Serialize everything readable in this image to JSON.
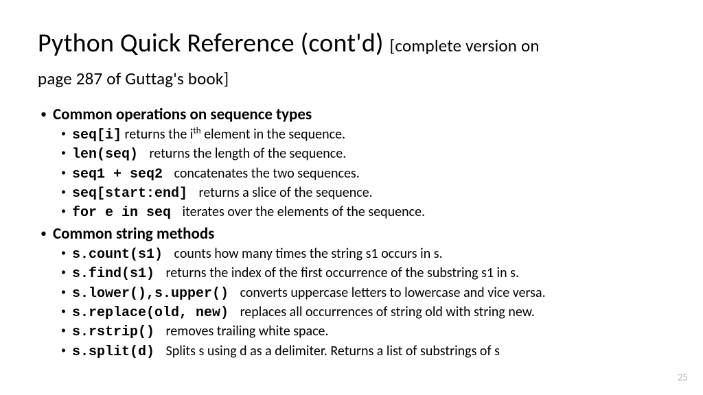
{
  "title_main": "Python Quick Reference (cont'd) ",
  "title_sub_a": "[complete version on",
  "title_sub_b": "page 287 of Guttag's book]",
  "section1": {
    "heading": "Common operations on sequence types",
    "items": [
      {
        "code": "seq[i]",
        "desc_pre": " returns the i",
        "sup": "th",
        "desc_post": " element in the sequence."
      },
      {
        "code": "len(seq) ",
        "desc": " returns the length of the sequence."
      },
      {
        "code": "seq1 + seq2 ",
        "desc": " concatenates the two sequences."
      },
      {
        "code": "seq[start:end] ",
        "desc": " returns a slice of the sequence."
      },
      {
        "code": "for e in seq ",
        "desc": " iterates over the elements of the sequence."
      }
    ]
  },
  "section2": {
    "heading": "Common string methods",
    "items": [
      {
        "code": "s.count(s1) ",
        "desc": " counts how many times the string s1 occurs in s."
      },
      {
        "code": "s.find(s1) ",
        "desc": " returns the index of the first occurrence of the substring s1 in s."
      },
      {
        "code": "s.lower(),s.upper() ",
        "desc": " converts uppercase letters to lowercase and vice versa."
      },
      {
        "code": "s.replace(old, new) ",
        "desc": " replaces all occurrences of string old with string new."
      },
      {
        "code": "s.rstrip() ",
        "desc": " removes trailing white space."
      },
      {
        "code": "s.split(d) ",
        "desc": " Splits s using d as a delimiter. Returns a list of substrings of s"
      }
    ]
  },
  "page_number": "25"
}
